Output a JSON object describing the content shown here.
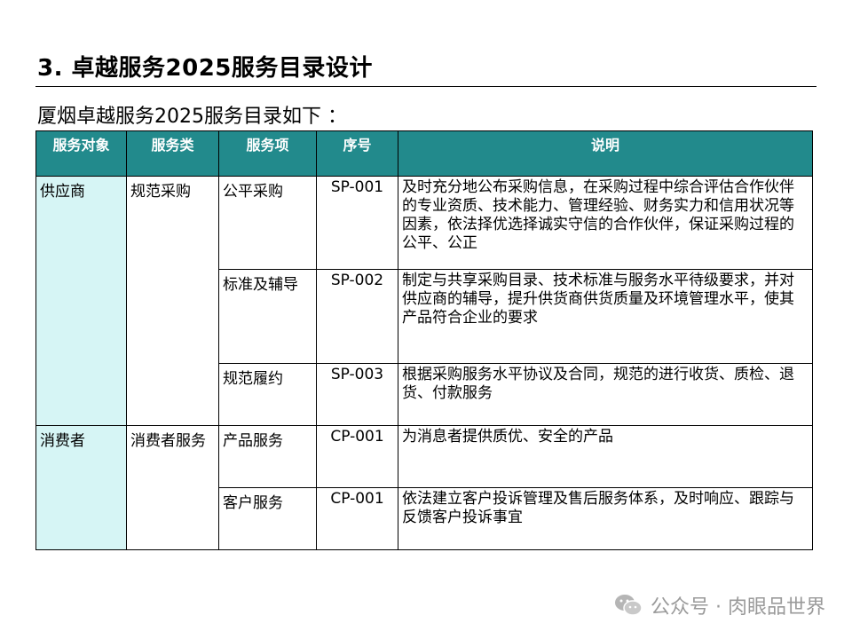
{
  "title": "3. 卓越服务2025服务目录设计",
  "subtitle": "厦烟卓越服务2025服务目录如下 ：",
  "table": {
    "headers": [
      "服务对象",
      "服务类",
      "服务项",
      "序号",
      "说明"
    ],
    "rows": [
      {
        "target": "供应商",
        "category": "规范采购",
        "item": "公平采购",
        "code": "SP-001",
        "desc": "及时充分地公布采购信息，在采购过程中综合评估合作伙伴的专业资质、技术能力、管理经验、财务实力和信用状况等因素，依法择优选择诚实守信的合作伙伴，保证采购过程的公平、公正"
      },
      {
        "item": "标准及辅导",
        "code": "SP-002",
        "desc": "制定与共享采购目录、技术标准与服务水平待级要求，并对供应商的辅导，提升供货商供货质量及环境管理水平，使其产品符合企业的要求"
      },
      {
        "item": "规范履约",
        "code": "SP-003",
        "desc": "根据采购服务水平协议及合同，规范的进行收货、质检、退货、付款服务"
      },
      {
        "target": "消费者",
        "category": "消费者服务",
        "item": "产品服务",
        "code": "CP-001",
        "desc": "为消息者提供质优、安全的产品"
      },
      {
        "item": "客户服务",
        "code": "CP-001",
        "desc": "依法建立客户投诉管理及售后服务体系，及时响应、跟踪与反馈客户投诉事宜"
      }
    ]
  },
  "watermark": "公众号 · 肉眼品世界",
  "colors": {
    "header_bg": "#228a8c",
    "target_bg": "#d6f5f5"
  }
}
